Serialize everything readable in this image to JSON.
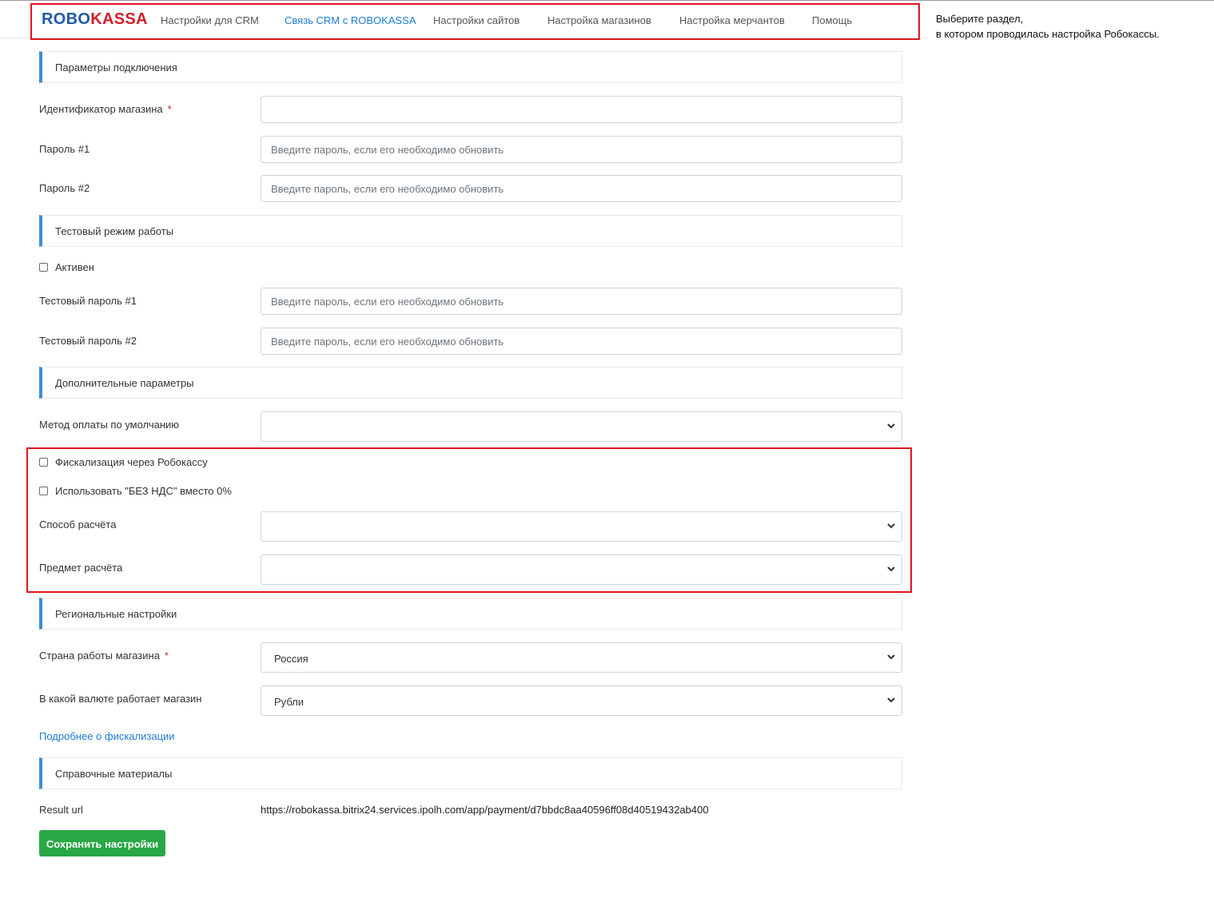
{
  "logo": {
    "part1": "ROBO",
    "part2": "KASSA"
  },
  "nav": {
    "items": [
      {
        "label": "Настройки для CRM"
      },
      {
        "label": "Связь CRM с ROBOKASSA"
      },
      {
        "label": "Настройки сайтов"
      },
      {
        "label": "Настройка магазинов"
      },
      {
        "label": "Настройка мерчантов"
      },
      {
        "label": "Помощь"
      }
    ],
    "active_index": 1
  },
  "hint": {
    "line1": "Выберите раздел,",
    "line2": "в котором проводилась настройка Робокассы."
  },
  "sections": {
    "connection": "Параметры подключения",
    "test_mode": "Тестовый режим работы",
    "additional": "Дополнительные параметры",
    "regional": "Региональные настройки",
    "reference": "Справочные материалы"
  },
  "fields": {
    "shop_id": {
      "label": "Идентификатор магазина",
      "required": "*",
      "value": ""
    },
    "password1": {
      "label": "Пароль #1",
      "placeholder": "Введите пароль, если его необходимо обновить"
    },
    "password2": {
      "label": "Пароль #2",
      "placeholder": "Введите пароль, если его необходимо обновить"
    },
    "test_active": {
      "label": "Активен",
      "checked": false
    },
    "test_password1": {
      "label": "Тестовый пароль #1",
      "placeholder": "Введите пароль, если его необходимо обновить"
    },
    "test_password2": {
      "label": "Тестовый пароль #2",
      "placeholder": "Введите пароль, если его необходимо обновить"
    },
    "payment_method": {
      "label": "Метод оплаты по умолчанию",
      "value": ""
    },
    "fiscalization": {
      "label": "Фискализация через Робокассу",
      "checked": false
    },
    "no_vat": {
      "label": "Использовать \"БЕЗ НДС\" вместо 0%",
      "checked": false
    },
    "calc_method": {
      "label": "Способ расчёта",
      "value": ""
    },
    "calc_subject": {
      "label": "Предмет расчёта",
      "value": ""
    },
    "country": {
      "label": "Страна работы магазина",
      "required": "*",
      "value": "Россия"
    },
    "currency": {
      "label": "В какой валюте работает магазин",
      "value": "Рубли"
    }
  },
  "fiscal_link": "Подробнее о фискализации",
  "result_url": {
    "label": "Result url",
    "value": "https://robokassa.bitrix24.services.ipolh.com/app/payment/d7bbdc8aa40596ff08d40519432ab400"
  },
  "save_button": "Сохранить настройки",
  "colors": {
    "accent": "#1a7bd5",
    "section_bar": "#3a8ed6",
    "save": "#28a745",
    "annotation": "#e0141e"
  }
}
